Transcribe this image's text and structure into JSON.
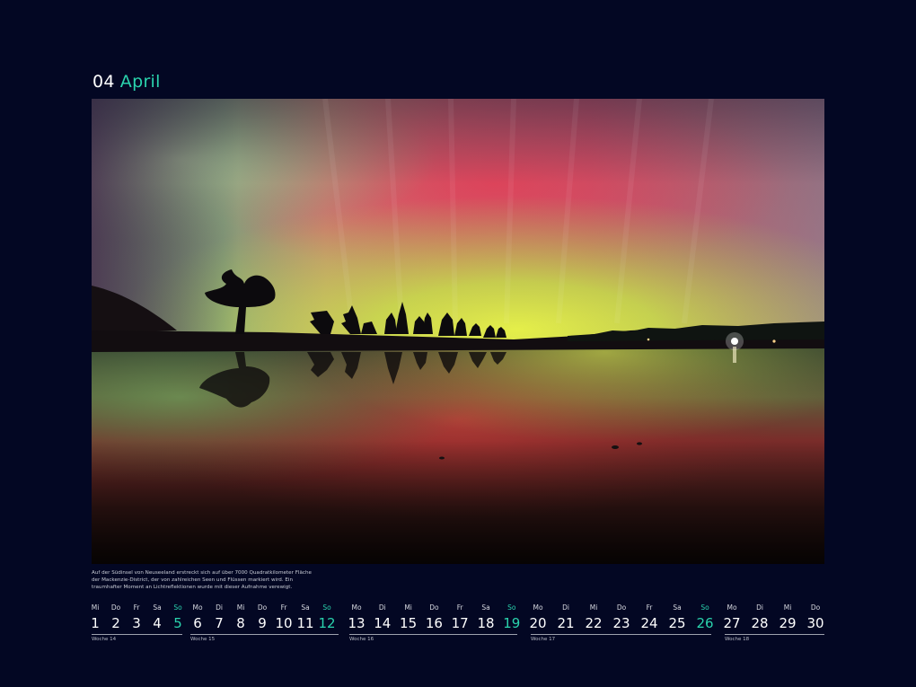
{
  "header": {
    "number": "04",
    "month": "April"
  },
  "caption": "Auf der Südinsel von Neuseeland erstreckt sich auf über 7000 Quadratkilometer Fläche der Mackenzie-District, der von zahlreichen Seen und Flüssen markiert wird. Ein traumhafter Moment an Lichtreflektionen wurde mit dieser Aufnahme verewigt.",
  "colors": {
    "background": "#030723",
    "accent": "#2ad3ad",
    "text": "#ffffff"
  },
  "weeks": [
    {
      "label": "Woche 14",
      "days": [
        {
          "dow": "Mi",
          "num": "1"
        },
        {
          "dow": "Do",
          "num": "2"
        },
        {
          "dow": "Fr",
          "num": "3"
        },
        {
          "dow": "Sa",
          "num": "4"
        },
        {
          "dow": "So",
          "num": "5",
          "sunday": true
        }
      ]
    },
    {
      "label": "Woche 15",
      "days": [
        {
          "dow": "Mo",
          "num": "6"
        },
        {
          "dow": "Di",
          "num": "7"
        },
        {
          "dow": "Mi",
          "num": "8"
        },
        {
          "dow": "Do",
          "num": "9"
        },
        {
          "dow": "Fr",
          "num": "10"
        },
        {
          "dow": "Sa",
          "num": "11"
        },
        {
          "dow": "So",
          "num": "12",
          "sunday": true
        }
      ]
    },
    {
      "label": "Woche 16",
      "days": [
        {
          "dow": "Mo",
          "num": "13"
        },
        {
          "dow": "Di",
          "num": "14"
        },
        {
          "dow": "Mi",
          "num": "15"
        },
        {
          "dow": "Do",
          "num": "16"
        },
        {
          "dow": "Fr",
          "num": "17"
        },
        {
          "dow": "Sa",
          "num": "18"
        },
        {
          "dow": "So",
          "num": "19",
          "sunday": true
        }
      ]
    },
    {
      "label": "Woche 17",
      "days": [
        {
          "dow": "Mo",
          "num": "20"
        },
        {
          "dow": "Di",
          "num": "21"
        },
        {
          "dow": "Mi",
          "num": "22"
        },
        {
          "dow": "Do",
          "num": "23"
        },
        {
          "dow": "Fr",
          "num": "24"
        },
        {
          "dow": "Sa",
          "num": "25"
        },
        {
          "dow": "So",
          "num": "26",
          "sunday": true
        }
      ]
    },
    {
      "label": "Woche 18",
      "days": [
        {
          "dow": "Mo",
          "num": "27"
        },
        {
          "dow": "Di",
          "num": "28"
        },
        {
          "dow": "Mi",
          "num": "29"
        },
        {
          "dow": "Do",
          "num": "30"
        }
      ]
    }
  ]
}
